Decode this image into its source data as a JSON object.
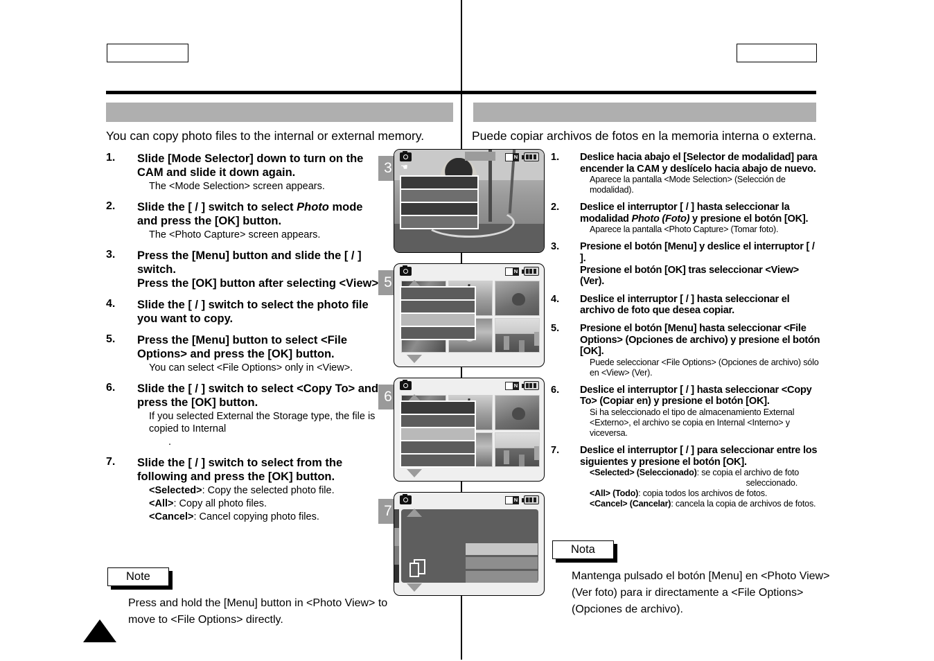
{
  "header": {
    "box_left_label": "",
    "box_right_label": "",
    "title_left": "",
    "title_right": ""
  },
  "left_column": {
    "intro": "You can copy photo files to the internal or external memory.",
    "steps": [
      {
        "num": "1.",
        "main": "Slide [Mode Selector] down to turn on the CAM and slide it down again.",
        "sub": "The <Mode Selection> screen appears."
      },
      {
        "num": "2.",
        "main_pre": "Slide the [    /    ] switch to select ",
        "main_ital": "Photo",
        "main_post": " mode and press the [OK] button.",
        "sub": "The <Photo Capture> screen appears."
      },
      {
        "num": "3.",
        "main": "Press the [Menu] button and slide the [    /    ] switch.",
        "main2": "Press the [OK] button after selecting <View>.",
        "sub": ""
      },
      {
        "num": "4.",
        "main": "Slide the [    /    ] switch to select the photo file you want to copy.",
        "sub": ""
      },
      {
        "num": "5.",
        "main": "Press the [Menu] button to select <File Options> and press the [OK] button.",
        "sub": "You can select <File Options> only in <View>."
      },
      {
        "num": "6.",
        "main": "Slide the [    /    ] switch to select <Copy To> and press the [OK] button.",
        "sub": "If you selected   External       the Storage type, the file is copied to   Internal",
        "sub2": "."
      },
      {
        "num": "7.",
        "main": "Slide the [    /    ] switch to select from the following and press the [OK] button.",
        "opt1_label": "<Selected>",
        "opt1_text": ": Copy the selected photo file.",
        "opt2_label": "<All>",
        "opt2_text": ": Copy all photo files.",
        "opt3_label": "<Cancel>",
        "opt3_text": ": Cancel copying photo files."
      }
    ],
    "note": {
      "tag": "Note",
      "body": "Press and hold the [Menu] button in <Photo View> to move to <File Options> directly."
    }
  },
  "right_column": {
    "intro": "Puede copiar archivos de fotos en la memoria interna o externa.",
    "steps": [
      {
        "num": "1.",
        "main": "Deslice hacia abajo el [Selector de modalidad] para encender la CAM y deslícelo hacia abajo de nuevo.",
        "sub": "Aparece la pantalla <Mode Selection> (Selección de modalidad)."
      },
      {
        "num": "2.",
        "main_pre": "Deslice el interruptor [   /   ] hasta seleccionar la modalidad ",
        "main_ital": "Photo (Foto)",
        "main_post": " y presione el botón [OK].",
        "sub": "Aparece la pantalla <Photo Capture> (Tomar foto)."
      },
      {
        "num": "3.",
        "main": "Presione el botón [Menu] y deslice el interruptor [   /   ].",
        "main2": "Presione el botón [OK] tras seleccionar <View> (Ver).",
        "sub": ""
      },
      {
        "num": "4.",
        "main": "Deslice el interruptor [   /   ] hasta seleccionar el archivo de foto que desea copiar.",
        "sub": ""
      },
      {
        "num": "5.",
        "main": "Presione el botón [Menu] hasta seleccionar <File Options> (Opciones de archivo) y presione el botón [OK].",
        "sub": "Puede seleccionar <File Options> (Opciones de archivo) sólo en <View> (Ver)."
      },
      {
        "num": "6.",
        "main": "Deslice el interruptor [   /   ] hasta seleccionar <Copy To> (Copiar en) y presione el botón [OK].",
        "sub": "Si ha seleccionado el tipo de almacenamiento External <Externo>, el archivo se copia en Internal <Interno> y viceversa."
      },
      {
        "num": "7.",
        "main": "Deslice el interruptor [   /   ] para seleccionar entre los siguientes y presione el botón [OK].",
        "opt1_label": "<Selected> (Seleccionado)",
        "opt1_text": ": se copia el archivo de foto",
        "opt1_text2": "seleccionado.",
        "opt2_label": "<All> (Todo)",
        "opt2_text": ": copia todos los archivos de fotos.",
        "opt3_label": "<Cancel> (Cancelar)",
        "opt3_text": ": cancela la copia de archivos de fotos."
      }
    ],
    "note": {
      "tag": "Nota",
      "body": "Mantenga pulsado el botón [Menu] en <Photo View> (Ver foto) para ir directamente a <File Options> (Opciones de archivo)."
    }
  },
  "screens": [
    {
      "badge": "3",
      "type": "photo-capture-menu",
      "icons": [
        "camera-icon",
        "hand-icon",
        "memory-card-icon",
        "battery-icon"
      ],
      "card_label": "N",
      "menu_rows": 4
    },
    {
      "badge": "5",
      "type": "thumbnail-grid-menu",
      "icons": [
        "camera-icon",
        "memory-card-icon",
        "battery-icon"
      ],
      "card_label": "N",
      "menu_rows": 4,
      "highlight_row": 3
    },
    {
      "badge": "6",
      "type": "thumbnail-grid-menu",
      "icons": [
        "camera-icon",
        "memory-card-icon",
        "battery-icon"
      ],
      "card_label": "N",
      "menu_rows": 5,
      "highlight_row": 3
    },
    {
      "badge": "7",
      "type": "copy-dialog",
      "icons": [
        "camera-icon",
        "memory-card-icon",
        "battery-icon",
        "copy-files-icon"
      ],
      "card_label": "N",
      "options": 3,
      "highlight_row": 1
    }
  ],
  "colors": {
    "title_bar": "#afafaf",
    "badge": "#9a9a9a",
    "rule": "#000000"
  }
}
